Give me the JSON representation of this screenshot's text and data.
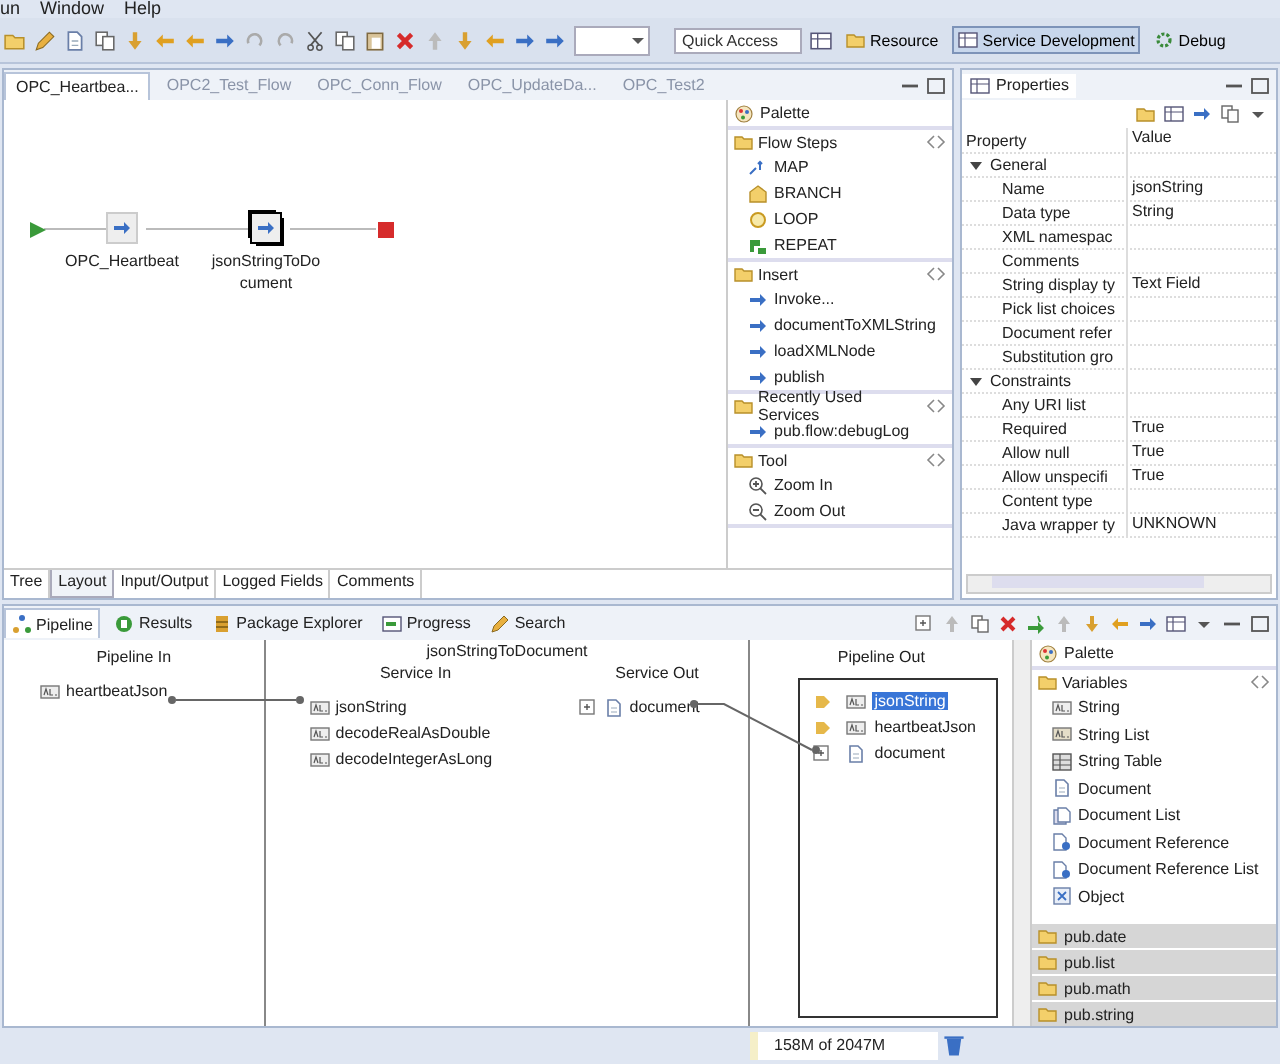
{
  "menu": [
    "un",
    "Window",
    "Help"
  ],
  "toolbar": {
    "quick_access": {
      "placeholder": "Quick Access"
    },
    "perspectives": [
      {
        "label": "Resource",
        "selected": false
      },
      {
        "label": "Service Development",
        "selected": true
      },
      {
        "label": "Debug",
        "selected": false
      }
    ]
  },
  "editor": {
    "tabs": [
      {
        "label": "OPC_Heartbea...",
        "selected": true
      },
      {
        "label": "OPC2_Test_Flow",
        "selected": false
      },
      {
        "label": "OPC_Conn_Flow",
        "selected": false
      },
      {
        "label": "OPC_UpdateDa...",
        "selected": false
      },
      {
        "label": "OPC_Test2",
        "selected": false
      }
    ],
    "flow_steps": [
      {
        "label": "OPC_Heartbeat",
        "selected": false
      },
      {
        "label": "jsonStringToDocument",
        "selected": true
      }
    ],
    "view_tabs": [
      {
        "label": "Tree",
        "selected": false
      },
      {
        "label": "Layout",
        "selected": true
      },
      {
        "label": "Input/Output",
        "selected": false
      },
      {
        "label": "Logged Fields",
        "selected": false
      },
      {
        "label": "Comments",
        "selected": false
      }
    ],
    "palette": {
      "title": "Palette",
      "groups": [
        {
          "name": "Flow Steps",
          "items": [
            {
              "label": "MAP",
              "kind": "map"
            },
            {
              "label": "BRANCH",
              "kind": "branch"
            },
            {
              "label": "LOOP",
              "kind": "loop"
            },
            {
              "label": "REPEAT",
              "kind": "repeat"
            }
          ]
        },
        {
          "name": "Insert",
          "items": [
            {
              "label": "Invoke...",
              "kind": "invoke"
            },
            {
              "label": "documentToXMLString",
              "kind": "invoke"
            },
            {
              "label": "loadXMLNode",
              "kind": "invoke"
            },
            {
              "label": "publish",
              "kind": "invoke"
            }
          ]
        },
        {
          "name": "Recently Used Services",
          "items": [
            {
              "label": "pub.flow:debugLog",
              "kind": "invoke"
            }
          ]
        },
        {
          "name": "Tool",
          "items": [
            {
              "label": "Zoom In",
              "kind": "zoomin"
            },
            {
              "label": "Zoom Out",
              "kind": "zoomout"
            }
          ]
        }
      ]
    }
  },
  "properties": {
    "title": "Properties",
    "columns": [
      "Property",
      "Value"
    ],
    "groups": [
      {
        "name": "General",
        "expanded": true,
        "rows": [
          {
            "property": "Name",
            "value": "jsonString"
          },
          {
            "property": "Data type",
            "value": "String"
          },
          {
            "property": "XML namespac"
          },
          {
            "property": "Comments"
          },
          {
            "property": "String display ty",
            "value": "Text Field"
          },
          {
            "property": "Pick list choices"
          },
          {
            "property": "Document refer"
          },
          {
            "property": "Substitution gro"
          }
        ]
      },
      {
        "name": "Constraints",
        "expanded": true,
        "rows": [
          {
            "property": "Any URI list"
          },
          {
            "property": "Required",
            "value": "True"
          },
          {
            "property": "Allow null",
            "value": "True"
          },
          {
            "property": "Allow unspecifi",
            "value": "True"
          },
          {
            "property": "Content type"
          },
          {
            "property": "Java wrapper ty",
            "value": "UNKNOWN"
          }
        ]
      }
    ]
  },
  "bottom_tabs": [
    {
      "label": "Pipeline",
      "selected": true
    },
    {
      "label": "Results",
      "selected": false
    },
    {
      "label": "Package Explorer",
      "selected": false
    },
    {
      "label": "Progress",
      "selected": false
    },
    {
      "label": "Search",
      "selected": false
    }
  ],
  "pipeline": {
    "pipeline_in": {
      "title": "Pipeline In",
      "items": [
        {
          "label": "heartbeatJson",
          "kind": "string"
        }
      ]
    },
    "service": {
      "title": "jsonStringToDocument",
      "service_in": {
        "title": "Service In",
        "items": [
          {
            "label": "jsonString",
            "kind": "string"
          },
          {
            "label": "decodeRealAsDouble",
            "kind": "string"
          },
          {
            "label": "decodeIntegerAsLong",
            "kind": "string"
          }
        ]
      },
      "service_out": {
        "title": "Service Out",
        "items": [
          {
            "label": "document",
            "kind": "document"
          }
        ]
      }
    },
    "pipeline_out": {
      "title": "Pipeline Out",
      "items": [
        {
          "label": "jsonString",
          "kind": "string",
          "selected": true,
          "marker": true
        },
        {
          "label": "heartbeatJson",
          "kind": "string",
          "selected": false,
          "marker": true
        },
        {
          "label": "document",
          "kind": "document",
          "selected": false,
          "marker": false
        }
      ]
    }
  },
  "variables_palette": {
    "title": "Palette",
    "group": "Variables",
    "items": [
      {
        "label": "String",
        "kind": "string"
      },
      {
        "label": "String List",
        "kind": "stringlist"
      },
      {
        "label": "String Table",
        "kind": "table"
      },
      {
        "label": "Document",
        "kind": "document"
      },
      {
        "label": "Document List",
        "kind": "doclist"
      },
      {
        "label": "Document Reference",
        "kind": "docref"
      },
      {
        "label": "Document Reference List",
        "kind": "docref"
      },
      {
        "label": "Object",
        "kind": "object"
      }
    ],
    "folders": [
      "pub.date",
      "pub.list",
      "pub.math",
      "pub.string"
    ]
  },
  "status_bar": {
    "memory": "158M of 2047M"
  }
}
